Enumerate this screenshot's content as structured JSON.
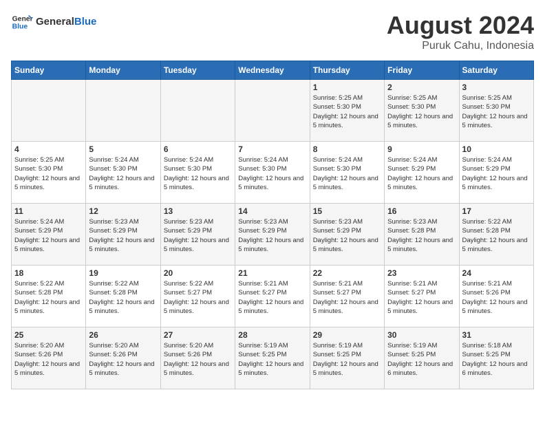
{
  "header": {
    "logo_general": "General",
    "logo_blue": "Blue",
    "main_title": "August 2024",
    "subtitle": "Puruk Cahu, Indonesia"
  },
  "weekdays": [
    "Sunday",
    "Monday",
    "Tuesday",
    "Wednesday",
    "Thursday",
    "Friday",
    "Saturday"
  ],
  "weeks": [
    [
      {
        "day": "",
        "sunrise": "",
        "sunset": "",
        "daylight": ""
      },
      {
        "day": "",
        "sunrise": "",
        "sunset": "",
        "daylight": ""
      },
      {
        "day": "",
        "sunrise": "",
        "sunset": "",
        "daylight": ""
      },
      {
        "day": "",
        "sunrise": "",
        "sunset": "",
        "daylight": ""
      },
      {
        "day": "1",
        "sunrise": "5:25 AM",
        "sunset": "5:30 PM",
        "daylight": "12 hours and 5 minutes."
      },
      {
        "day": "2",
        "sunrise": "5:25 AM",
        "sunset": "5:30 PM",
        "daylight": "12 hours and 5 minutes."
      },
      {
        "day": "3",
        "sunrise": "5:25 AM",
        "sunset": "5:30 PM",
        "daylight": "12 hours and 5 minutes."
      }
    ],
    [
      {
        "day": "4",
        "sunrise": "5:25 AM",
        "sunset": "5:30 PM",
        "daylight": "12 hours and 5 minutes."
      },
      {
        "day": "5",
        "sunrise": "5:24 AM",
        "sunset": "5:30 PM",
        "daylight": "12 hours and 5 minutes."
      },
      {
        "day": "6",
        "sunrise": "5:24 AM",
        "sunset": "5:30 PM",
        "daylight": "12 hours and 5 minutes."
      },
      {
        "day": "7",
        "sunrise": "5:24 AM",
        "sunset": "5:30 PM",
        "daylight": "12 hours and 5 minutes."
      },
      {
        "day": "8",
        "sunrise": "5:24 AM",
        "sunset": "5:30 PM",
        "daylight": "12 hours and 5 minutes."
      },
      {
        "day": "9",
        "sunrise": "5:24 AM",
        "sunset": "5:29 PM",
        "daylight": "12 hours and 5 minutes."
      },
      {
        "day": "10",
        "sunrise": "5:24 AM",
        "sunset": "5:29 PM",
        "daylight": "12 hours and 5 minutes."
      }
    ],
    [
      {
        "day": "11",
        "sunrise": "5:24 AM",
        "sunset": "5:29 PM",
        "daylight": "12 hours and 5 minutes."
      },
      {
        "day": "12",
        "sunrise": "5:23 AM",
        "sunset": "5:29 PM",
        "daylight": "12 hours and 5 minutes."
      },
      {
        "day": "13",
        "sunrise": "5:23 AM",
        "sunset": "5:29 PM",
        "daylight": "12 hours and 5 minutes."
      },
      {
        "day": "14",
        "sunrise": "5:23 AM",
        "sunset": "5:29 PM",
        "daylight": "12 hours and 5 minutes."
      },
      {
        "day": "15",
        "sunrise": "5:23 AM",
        "sunset": "5:29 PM",
        "daylight": "12 hours and 5 minutes."
      },
      {
        "day": "16",
        "sunrise": "5:23 AM",
        "sunset": "5:28 PM",
        "daylight": "12 hours and 5 minutes."
      },
      {
        "day": "17",
        "sunrise": "5:22 AM",
        "sunset": "5:28 PM",
        "daylight": "12 hours and 5 minutes."
      }
    ],
    [
      {
        "day": "18",
        "sunrise": "5:22 AM",
        "sunset": "5:28 PM",
        "daylight": "12 hours and 5 minutes."
      },
      {
        "day": "19",
        "sunrise": "5:22 AM",
        "sunset": "5:28 PM",
        "daylight": "12 hours and 5 minutes."
      },
      {
        "day": "20",
        "sunrise": "5:22 AM",
        "sunset": "5:27 PM",
        "daylight": "12 hours and 5 minutes."
      },
      {
        "day": "21",
        "sunrise": "5:21 AM",
        "sunset": "5:27 PM",
        "daylight": "12 hours and 5 minutes."
      },
      {
        "day": "22",
        "sunrise": "5:21 AM",
        "sunset": "5:27 PM",
        "daylight": "12 hours and 5 minutes."
      },
      {
        "day": "23",
        "sunrise": "5:21 AM",
        "sunset": "5:27 PM",
        "daylight": "12 hours and 5 minutes."
      },
      {
        "day": "24",
        "sunrise": "5:21 AM",
        "sunset": "5:26 PM",
        "daylight": "12 hours and 5 minutes."
      }
    ],
    [
      {
        "day": "25",
        "sunrise": "5:20 AM",
        "sunset": "5:26 PM",
        "daylight": "12 hours and 5 minutes."
      },
      {
        "day": "26",
        "sunrise": "5:20 AM",
        "sunset": "5:26 PM",
        "daylight": "12 hours and 5 minutes."
      },
      {
        "day": "27",
        "sunrise": "5:20 AM",
        "sunset": "5:26 PM",
        "daylight": "12 hours and 5 minutes."
      },
      {
        "day": "28",
        "sunrise": "5:19 AM",
        "sunset": "5:25 PM",
        "daylight": "12 hours and 5 minutes."
      },
      {
        "day": "29",
        "sunrise": "5:19 AM",
        "sunset": "5:25 PM",
        "daylight": "12 hours and 5 minutes."
      },
      {
        "day": "30",
        "sunrise": "5:19 AM",
        "sunset": "5:25 PM",
        "daylight": "12 hours and 6 minutes."
      },
      {
        "day": "31",
        "sunrise": "5:18 AM",
        "sunset": "5:25 PM",
        "daylight": "12 hours and 6 minutes."
      }
    ]
  ]
}
